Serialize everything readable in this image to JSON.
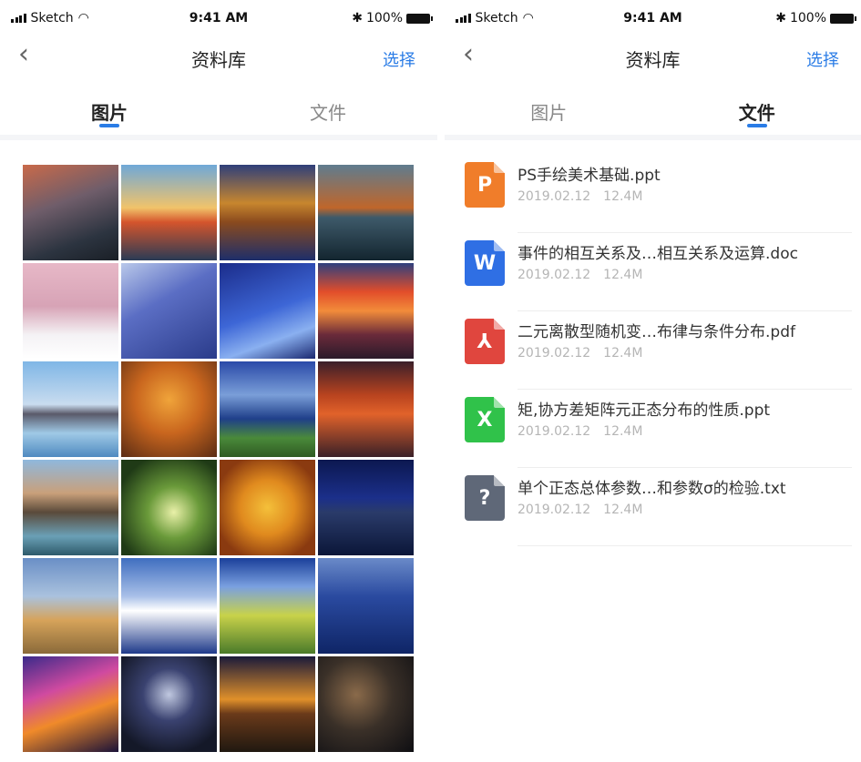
{
  "status": {
    "carrier": "Sketch",
    "time": "9:41 AM",
    "battery": "100%"
  },
  "nav": {
    "back_icon": "chevron-left-icon",
    "title": "资料库",
    "select_label": "选择"
  },
  "tabs": [
    {
      "label": "图片"
    },
    {
      "label": "文件"
    }
  ],
  "left_active_tab": 0,
  "right_active_tab": 1,
  "photos": [
    {
      "theme": "coast-lighthouse-sunset"
    },
    {
      "theme": "lake-sunset-clouds"
    },
    {
      "theme": "autumn-forest-mountains"
    },
    {
      "theme": "reflection-island-tree"
    },
    {
      "theme": "snow-tree-pink"
    },
    {
      "theme": "snowy-mountain-blue"
    },
    {
      "theme": "ice-blue"
    },
    {
      "theme": "red-sky-dunes"
    },
    {
      "theme": "pagoda-water"
    },
    {
      "theme": "orange-autumn-tree"
    },
    {
      "theme": "lake-mountain-meadow"
    },
    {
      "theme": "red-sunset-sea"
    },
    {
      "theme": "canal-town"
    },
    {
      "theme": "green-tunnel"
    },
    {
      "theme": "maple-leaf"
    },
    {
      "theme": "dusk-lake"
    },
    {
      "theme": "bride-field"
    },
    {
      "theme": "fuji-clouds"
    },
    {
      "theme": "green-hills"
    },
    {
      "theme": "blue-rocks-shore"
    },
    {
      "theme": "aurora-fire"
    },
    {
      "theme": "star-trails"
    },
    {
      "theme": "stonehenge-sunset"
    },
    {
      "theme": "dark-canyon"
    }
  ],
  "files": [
    {
      "icon": "ppt-icon",
      "letter": "P",
      "color": "#f07d2a",
      "name": "PS手绘美术基础.ppt",
      "date": "2019.02.12",
      "size": "12.4M"
    },
    {
      "icon": "word-icon",
      "letter": "W",
      "color": "#2f6fe4",
      "name": "事件的相互关系及…相互关系及运算.doc",
      "date": "2019.02.12",
      "size": "12.4M"
    },
    {
      "icon": "pdf-icon",
      "letter": "⅄",
      "color": "#e0463e",
      "name": "二元离散型随机变…布律与条件分布.pdf",
      "date": "2019.02.12",
      "size": "12.4M"
    },
    {
      "icon": "excel-icon",
      "letter": "X",
      "color": "#30c24a",
      "name": "矩,协方差矩阵元正态分布的性质.ppt",
      "date": "2019.02.12",
      "size": "12.4M"
    },
    {
      "icon": "unknown-file-icon",
      "letter": "?",
      "color": "#5f6878",
      "name": "单个正态总体参数…和参数σ的检验.txt",
      "date": "2019.02.12",
      "size": "12.4M"
    }
  ]
}
